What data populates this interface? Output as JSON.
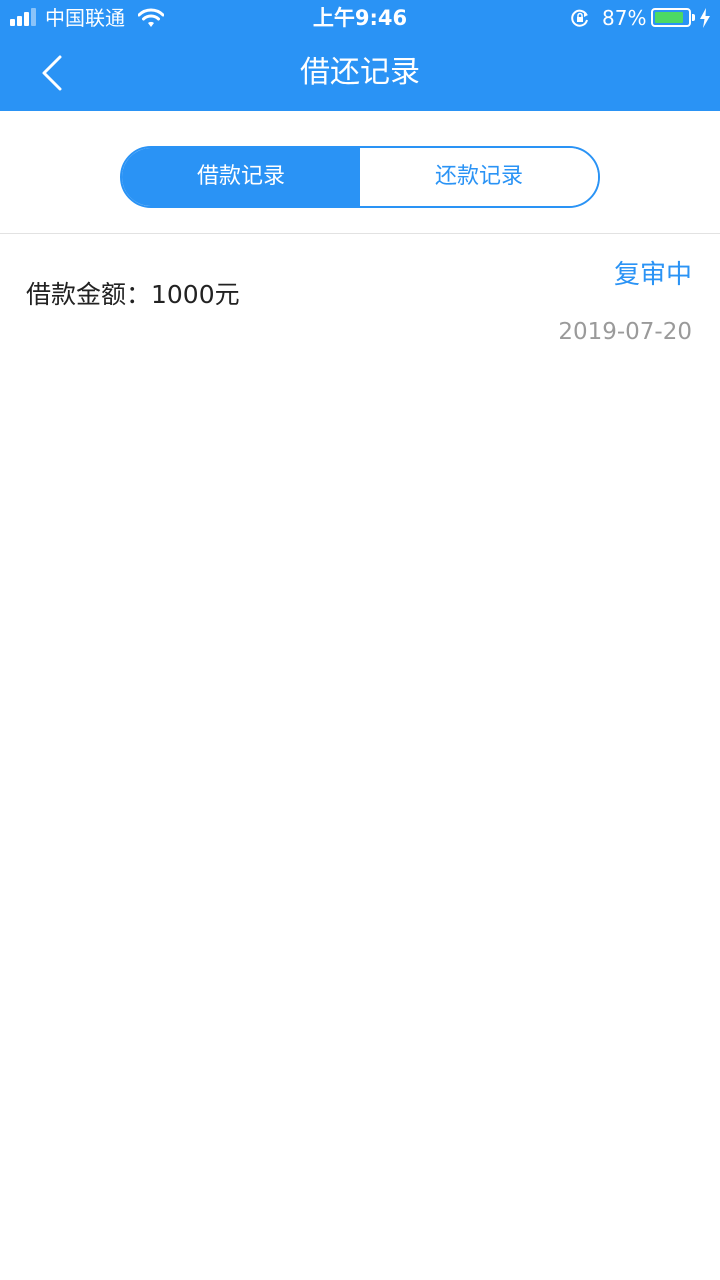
{
  "status_bar": {
    "carrier": "中国联通",
    "time": "上午9:46",
    "battery_percent": "87%",
    "battery_level": 0.87,
    "icons": [
      "signal-icon",
      "wifi-icon",
      "orientation-lock-icon",
      "battery-icon",
      "charging-icon"
    ]
  },
  "nav": {
    "title": "借还记录",
    "back_icon": "chevron-left-icon"
  },
  "tabs": [
    {
      "label": "借款记录",
      "active": true
    },
    {
      "label": "还款记录",
      "active": false
    }
  ],
  "records": [
    {
      "amount_text": "借款金额：1000元",
      "status": "复审中",
      "date": "2019-07-20"
    }
  ],
  "colors": {
    "accent": "#2a93f5",
    "battery_fill": "#4cd964",
    "date_text": "#9a9a9a"
  }
}
